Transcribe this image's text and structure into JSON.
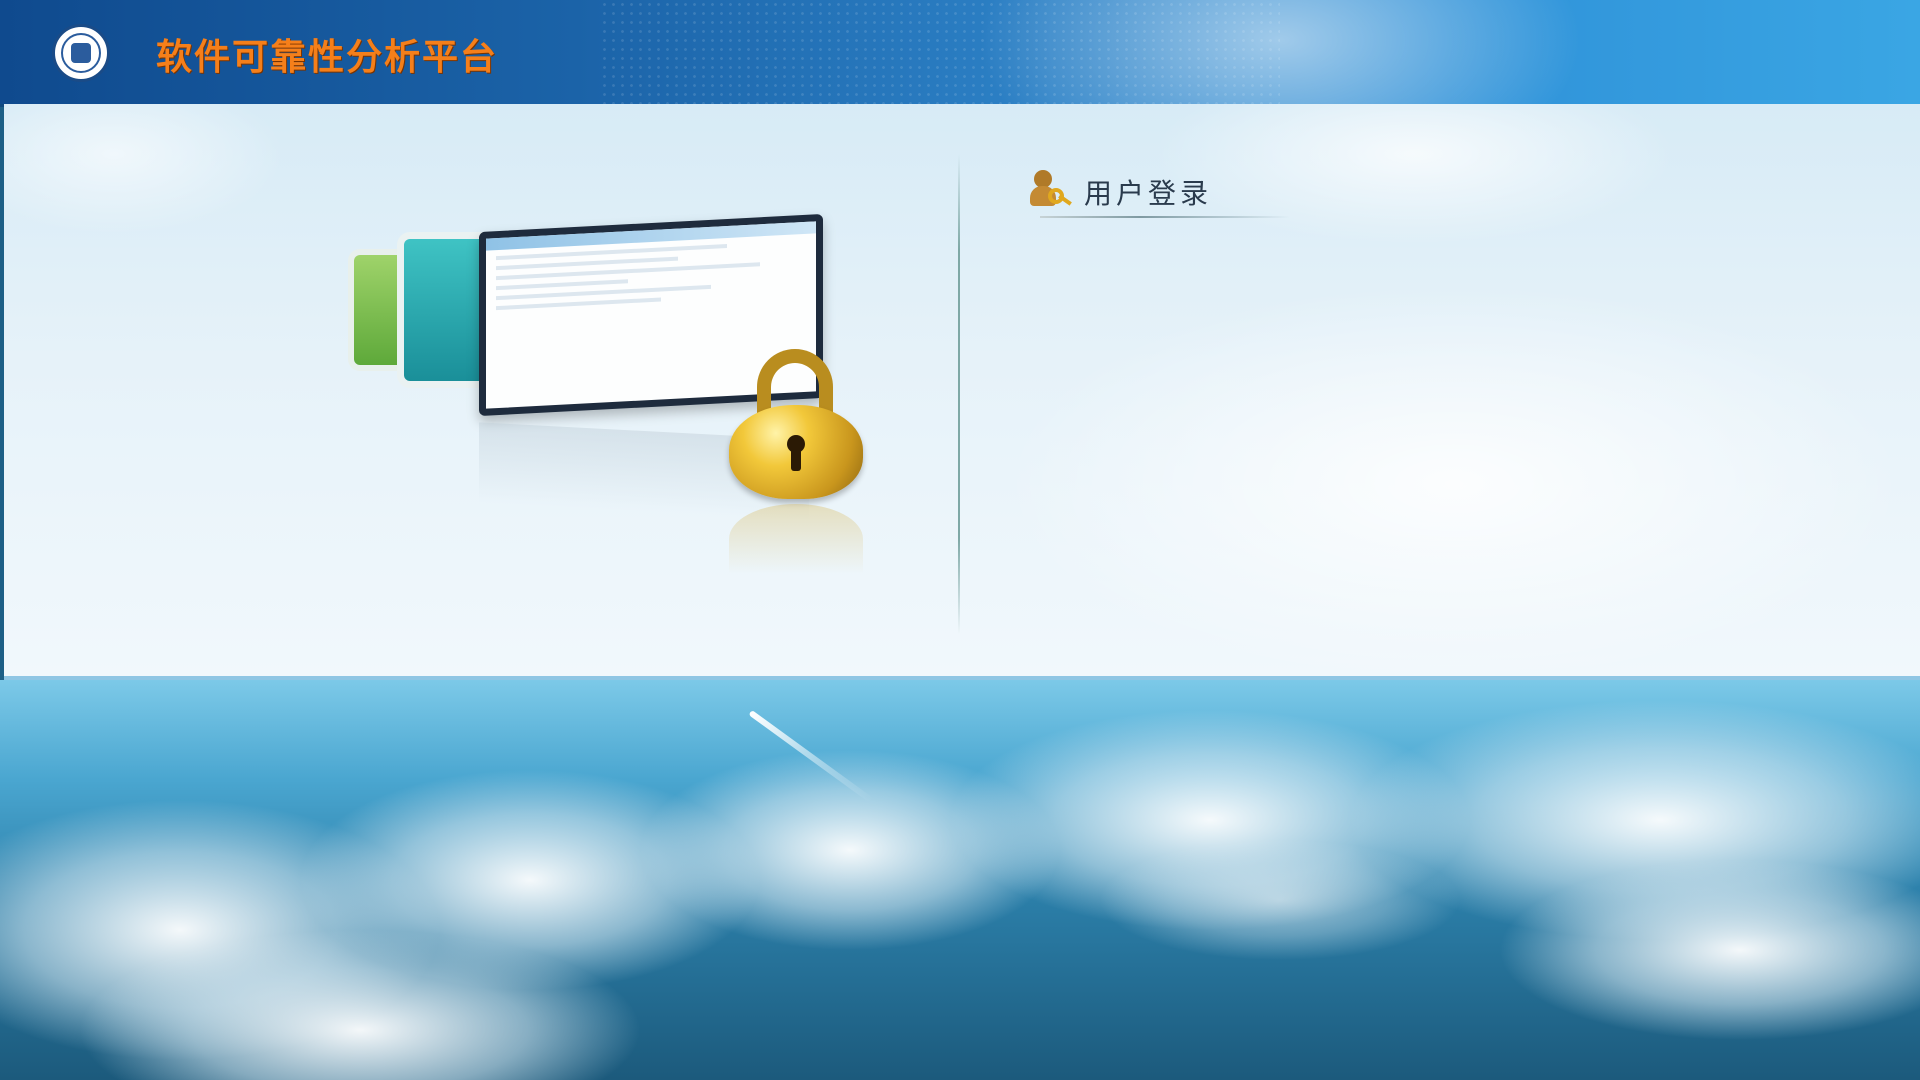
{
  "header": {
    "app_title": "软件可靠性分析平台",
    "logo_icon": "university-seal-icon",
    "colors": {
      "title": "#f57f1a",
      "bar": "#1b63a8"
    }
  },
  "login": {
    "title": "用户登录",
    "icon": "user-key-icon"
  },
  "illustration": {
    "icon": "padlock-icon",
    "screen_icon": "application-window-icon"
  }
}
